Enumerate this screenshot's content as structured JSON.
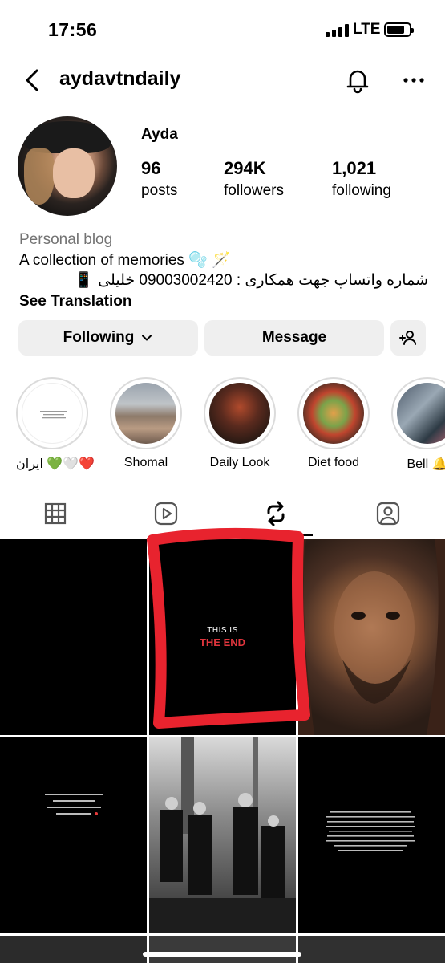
{
  "status": {
    "time": "17:56",
    "network": "LTE"
  },
  "header": {
    "username": "aydavtndaily"
  },
  "profile": {
    "name": "Ayda",
    "stats": [
      {
        "value": "96",
        "label": "posts"
      },
      {
        "value": "294K",
        "label": "followers"
      },
      {
        "value": "1,021",
        "label": "following"
      }
    ],
    "category": "Personal blog",
    "bio_line1": "A collection of memories 🫧 🪄",
    "bio_line2": "شماره واتساپ جهت همکاری : 09003002420 خلیلی",
    "bio_line2_emoji": "📱",
    "see_translation": "See Translation"
  },
  "buttons": {
    "following": "Following",
    "message": "Message"
  },
  "highlights": [
    {
      "label": "ایران 💚🤍❤️"
    },
    {
      "label": "Shomal"
    },
    {
      "label": "Daily Look"
    },
    {
      "label": "Diet food"
    },
    {
      "label": "Bell 🔔"
    }
  ],
  "grid": {
    "post2_line1": "THIS IS",
    "post2_line2": "THE END"
  },
  "colors": {
    "accent_red": "#e8232e",
    "button_bg": "#efefef",
    "muted": "#737373"
  }
}
